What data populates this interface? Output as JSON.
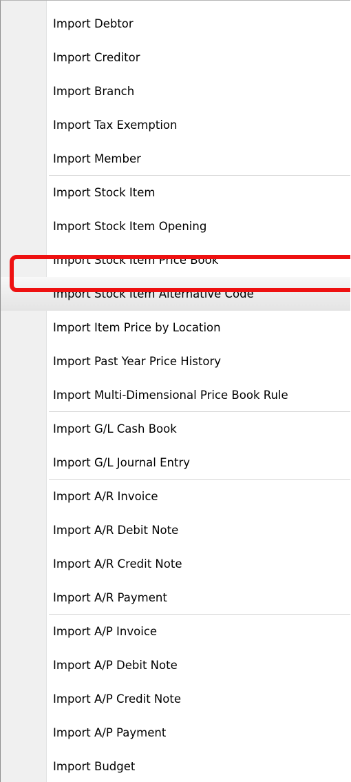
{
  "menu": {
    "items": [
      {
        "label": "Import Debtor"
      },
      {
        "label": "Import Creditor"
      },
      {
        "label": "Import Branch"
      },
      {
        "label": "Import Tax Exemption"
      },
      {
        "label": "Import Member"
      },
      {
        "label": "Import Stock Item"
      },
      {
        "label": "Import Stock Item Opening"
      },
      {
        "label": "Import Stock Item Price Book"
      },
      {
        "label": "Import Stock Item Alternative Code"
      },
      {
        "label": "Import Item Price by Location"
      },
      {
        "label": "Import Past Year Price History"
      },
      {
        "label": "Import Multi-Dimensional Price Book Rule"
      },
      {
        "label": "Import G/L Cash Book"
      },
      {
        "label": "Import G/L Journal Entry"
      },
      {
        "label": "Import A/R Invoice"
      },
      {
        "label": "Import A/R Debit Note"
      },
      {
        "label": "Import A/R Credit Note"
      },
      {
        "label": "Import A/R Payment"
      },
      {
        "label": "Import A/P Invoice"
      },
      {
        "label": "Import A/P Debit Note"
      },
      {
        "label": "Import A/P Credit Note"
      },
      {
        "label": "Import A/P Payment"
      },
      {
        "label": "Import Budget"
      }
    ]
  },
  "colors": {
    "highlight_outline": "#ee1111",
    "gutter": "#f0f0f0",
    "separator": "#d4d4d4"
  }
}
